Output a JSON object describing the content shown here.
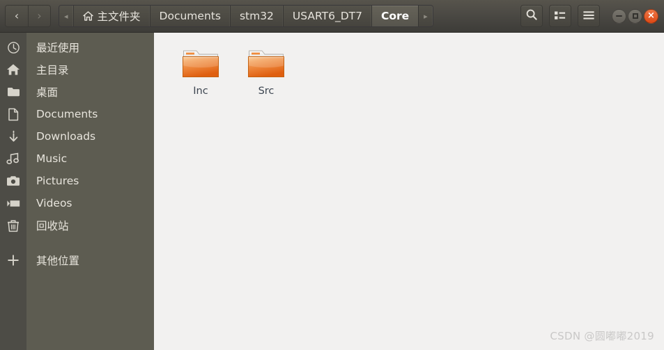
{
  "titlebar": {
    "nav": {
      "back_label": "‹",
      "back_name": "back-button",
      "forward_label": "›",
      "forward_name": "forward-button"
    },
    "breadcrumbs": [
      {
        "label": "◂",
        "type": "scroll-left",
        "icon": "",
        "active": false
      },
      {
        "label": "主文件夹",
        "type": "crumb",
        "icon": "home-icon",
        "active": false
      },
      {
        "label": "Documents",
        "type": "crumb",
        "icon": "",
        "active": false
      },
      {
        "label": "stm32",
        "type": "crumb",
        "icon": "",
        "active": false
      },
      {
        "label": "USART6_DT7",
        "type": "crumb",
        "icon": "",
        "active": false
      },
      {
        "label": "Core",
        "type": "crumb",
        "icon": "",
        "active": true
      },
      {
        "label": "▸",
        "type": "scroll-right",
        "icon": "",
        "active": false
      }
    ],
    "tools": [
      {
        "name": "search-icon",
        "label": "search"
      },
      {
        "name": "view-list-icon",
        "label": "view options"
      },
      {
        "name": "hamburger-menu-icon",
        "label": "menu"
      }
    ],
    "window_controls": [
      {
        "name": "minimize-button",
        "glyph": "−"
      },
      {
        "name": "maximize-button",
        "glyph": "□"
      },
      {
        "name": "close-button",
        "glyph": "×"
      }
    ]
  },
  "sidebar": {
    "items": [
      {
        "label": "最近使用",
        "icon": "clock-icon"
      },
      {
        "label": "主目录",
        "icon": "home-icon"
      },
      {
        "label": "桌面",
        "icon": "folder-icon"
      },
      {
        "label": "Documents",
        "icon": "document-icon"
      },
      {
        "label": "Downloads",
        "icon": "download-icon"
      },
      {
        "label": "Music",
        "icon": "music-icon"
      },
      {
        "label": "Pictures",
        "icon": "camera-icon"
      },
      {
        "label": "Videos",
        "icon": "video-icon"
      },
      {
        "label": "回收站",
        "icon": "trash-icon"
      },
      {
        "label": "其他位置",
        "icon": "plus-icon"
      }
    ]
  },
  "content": {
    "files": [
      {
        "name": "Inc",
        "type": "folder"
      },
      {
        "name": "Src",
        "type": "folder"
      }
    ],
    "watermark": "CSDN @圆嘟嘟2019"
  },
  "colors": {
    "titlebar_top": "#57544c",
    "titlebar_bottom": "#3d3c38",
    "sidebar": "#5d5c51",
    "icon_column": "#4d4c46",
    "content_bg": "#f2f1f0",
    "folder_orange": "#e8732a",
    "close_button": "#dd4814",
    "label_text": "#3c4550"
  }
}
